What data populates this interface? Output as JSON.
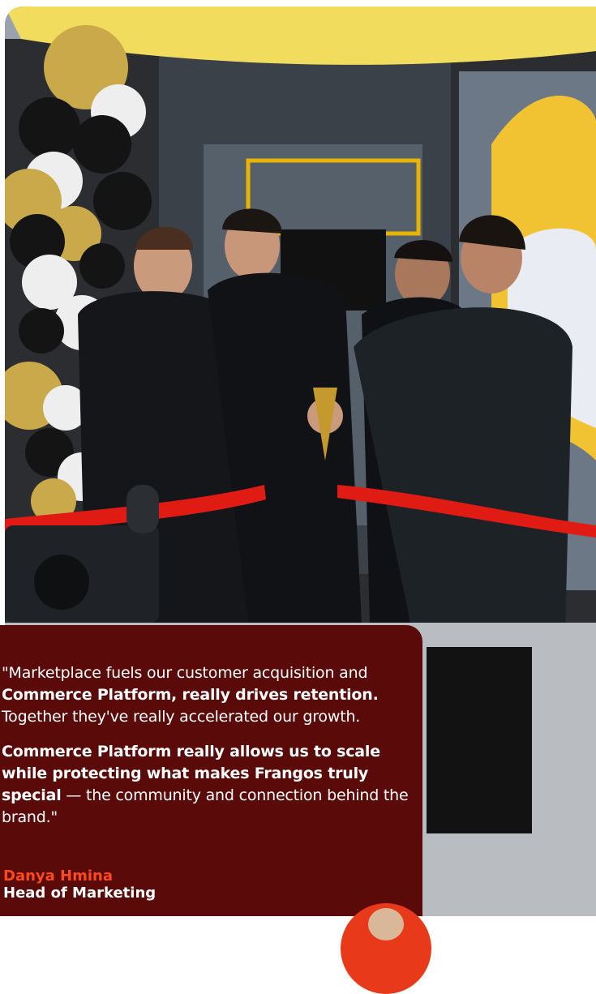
{
  "photo": {
    "icon": "ribbon-cutting-photo"
  },
  "quote": {
    "p1_a": "\"Marketplace fuels our customer acquisition and ",
    "p1_b": "Commerce Platform, really drives retention.",
    "p1_c": " Together they've really accelerated our growth.",
    "p2_a": "Commerce Platform really allows us to scale while protecting what makes Frangos truly special",
    "p2_b": " — the community and connection behind the brand.\""
  },
  "attribution": {
    "name": "Danya Hmina",
    "role": "Head of Marketing"
  },
  "colors": {
    "card_bg": "#5a0a08",
    "name_accent": "#ff4a1e",
    "avatar_bg": "#e8391a",
    "ribbon": "#e01b14"
  }
}
